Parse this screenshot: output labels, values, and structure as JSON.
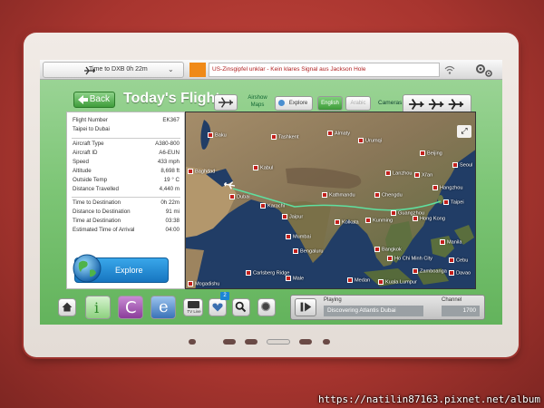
{
  "topbar": {
    "time_to_dest": "Time to DXB 0h 22m",
    "news_source_logo": "REUTERS",
    "news_ticker": "US-Zinsgipfel unklar - Kein klares Signal aus Jackson Hole",
    "icons": [
      "plane-icon",
      "chevron-down-icon",
      "wifi-icon",
      "settings-gear-icon"
    ]
  },
  "header": {
    "back_label": "Back",
    "title": "Today's Flight",
    "airshow_maps": "Airshow Maps",
    "explore_tab": "Explore",
    "english_lang": "English",
    "arabic_lang": "Arabic",
    "cameras_label": "Cameras"
  },
  "info": {
    "flight_number_label": "Flight Number",
    "flight_number": "EK367",
    "route": "Taipei to Dubai",
    "rows": [
      {
        "label": "Aircraft Type",
        "value": "A380-800"
      },
      {
        "label": "Aircraft ID",
        "value": "A6-EUN"
      },
      {
        "label": "Speed",
        "value": "433 mph"
      },
      {
        "label": "Altitude",
        "value": "8,698 ft"
      },
      {
        "label": "Outside Temp",
        "value": "19 ° C"
      },
      {
        "label": "Distance Travelled",
        "value": "4,440 m"
      }
    ],
    "rows2": [
      {
        "label": "Time to Destination",
        "value": "0h 22m"
      },
      {
        "label": "Distance to Destination",
        "value": "91 mi"
      },
      {
        "label": "Time at Destination",
        "value": "03:38"
      },
      {
        "label": "Estimated Time of Arrival",
        "value": "04:00"
      }
    ],
    "explore_button": "Explore"
  },
  "map": {
    "cities": [
      "Baku",
      "Tashkent",
      "Almaty",
      "Urumqi",
      "Beijing",
      "Seoul",
      "Baghdad",
      "Kabul",
      "Lanzhou",
      "Xi'an",
      "Hangzhou",
      "Dubai",
      "Karachi",
      "Kathmandu",
      "Chengdu",
      "Taipei",
      "Jaipur",
      "Kolkata",
      "Kunming",
      "Guangzhou",
      "Mumbai",
      "Hong Kong",
      "Bengaluru",
      "Bangkok",
      "Manila",
      "Ho Chi Minh City",
      "Cebu",
      "Zamboanga",
      "Davao",
      "Male",
      "Medan",
      "Kuala Lumpur",
      "Mogadishu",
      "Carlsberg Ridge"
    ]
  },
  "bottom": {
    "tv_label": "TV Live",
    "badge_count": "2",
    "playing_label": "Playing",
    "playing_value": "Discovering Atlantis Dubai",
    "channel_label": "Channel",
    "channel_value": "1700"
  },
  "watermark": "https://natilin87163.pixnet.net/album",
  "colors": {
    "seatback": "#b23a33",
    "screen_green": "#7cc575",
    "explore_blue": "#1c86d4",
    "flight_path": "#5fe0a0",
    "city_marker": "#c2201c"
  }
}
